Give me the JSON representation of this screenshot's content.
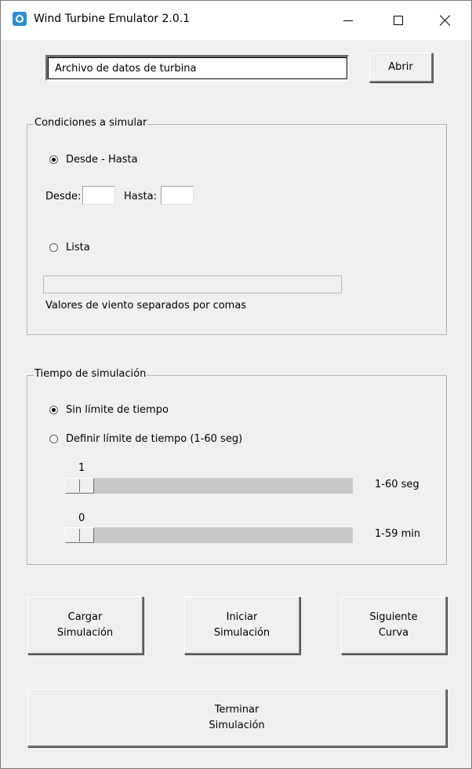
{
  "window": {
    "title": "Wind Turbine Emulator 2.0.1"
  },
  "file": {
    "value": "Archivo de datos de turbina",
    "open_label": "Abrir"
  },
  "conditions": {
    "legend": "Condiciones a simular",
    "range_option": "Desde - Hasta",
    "range_selected": true,
    "from_label": "Desde:",
    "to_label": "Hasta:",
    "from_value": "",
    "to_value": "",
    "list_option": "Lista",
    "list_selected": false,
    "list_value": "",
    "list_hint": "Valores de viento separados por comas"
  },
  "time": {
    "legend": "Tiempo de simulación",
    "unlimited_option": "Sin límite de tiempo",
    "unlimited_selected": true,
    "limit_option": "Definir límite de tiempo (1-60 seg)",
    "limit_selected": false,
    "seconds_value": "1",
    "seconds_label": "1-60 seg",
    "minutes_value": "0",
    "minutes_label": "1-59 min"
  },
  "actions": {
    "load_line1": "Cargar",
    "load_line2": "Simulación",
    "start_line1": "Iniciar",
    "start_line2": "Simulación",
    "next_line1": "Siguiente",
    "next_line2": "Curva",
    "end_line1": "Terminar",
    "end_line2": "Simulación"
  },
  "icons": {
    "app": "wind-turbine-app-icon",
    "minimize": "minimize-icon",
    "maximize": "maximize-icon",
    "close": "close-icon"
  }
}
